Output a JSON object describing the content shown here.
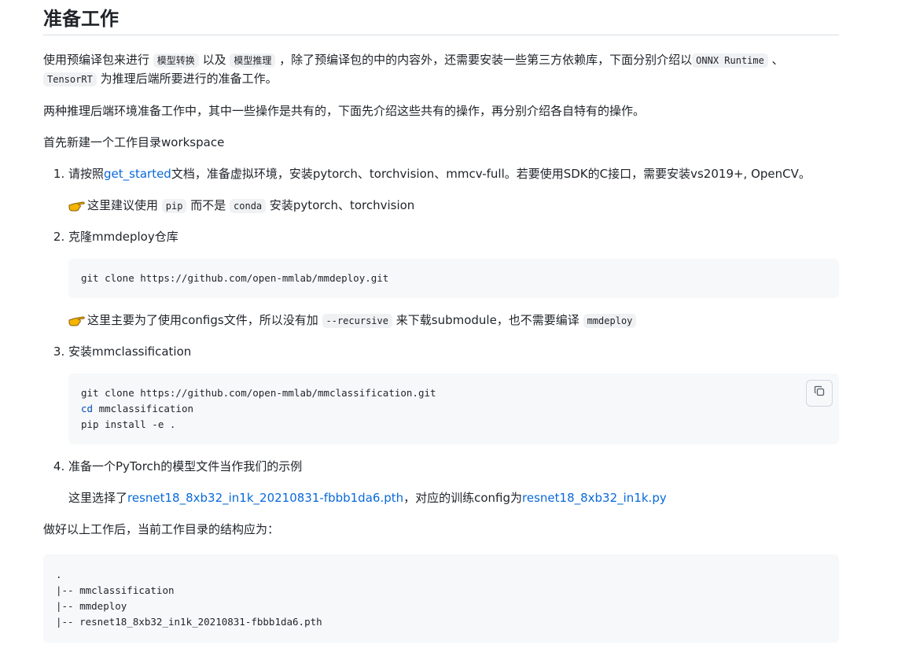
{
  "heading": "准备工作",
  "intro": {
    "t1": "使用预编译包来进行 ",
    "c1": "模型转换",
    "t2": " 以及 ",
    "c2": "模型推理",
    "t3": " ，除了预编译包的中的内容外，还需要安装一些第三方依赖库，下面分别介绍以",
    "c3": "ONNX Runtime",
    "t4": " 、",
    "c4": "TensorRT",
    "t5": " 为推理后端所要进行的准备工作。"
  },
  "para2": "两种推理后端环境准备工作中，其中一些操作是共有的，下面先介绍这些共有的操作，再分别介绍各自特有的操作。",
  "para3": "首先新建一个工作目录workspace",
  "steps": {
    "s1": {
      "t1": "请按照",
      "link": "get_started",
      "t2": "文档，准备虚拟环境，安装pytorch、torchvision、mmcv-full。若要使用SDK的C接口，需要安装vs2019+, OpenCV。",
      "note": {
        "t1": "这里建议使用 ",
        "c1": "pip",
        "t2": " 而不是 ",
        "c2": "conda",
        "t3": " 安装pytorch、torchvision"
      }
    },
    "s2": {
      "text": "克隆mmdeploy仓库",
      "code": "git clone https://github.com/open-mmlab/mmdeploy.git",
      "note": {
        "t1": "这里主要为了使用configs文件，所以没有加 ",
        "c1": "--recursive",
        "t2": " 来下载submodule，也不需要编译 ",
        "c2": "mmdeploy"
      }
    },
    "s3": {
      "text": "安装mmclassification",
      "line1": "git clone https://github.com/open-mmlab/mmclassification.git",
      "line2_kw": "cd",
      "line2_rest": " mmclassification",
      "line3": "pip install -e ."
    },
    "s4": {
      "text": "准备一个PyTorch的模型文件当作我们的示例",
      "sub": {
        "t1": "这里选择了",
        "link1": "resnet18_8xb32_in1k_20210831-fbbb1da6.pth",
        "t2": "，对应的训练config为",
        "link2": "resnet18_8xb32_in1k.py"
      }
    }
  },
  "after": "做好以上工作后，当前工作目录的结构应为：",
  "tree": [
    ".",
    "|-- mmclassification",
    "|-- mmdeploy",
    "|-- resnet18_8xb32_in1k_20210831-fbbb1da6.pth"
  ],
  "icons": {
    "note": "pointing-hand-icon",
    "copy": "copy-icon"
  },
  "colors": {
    "link": "#0969da",
    "code_bg": "#f6f8fa",
    "keyword": "#0550ae",
    "hand": "#f4b400"
  }
}
